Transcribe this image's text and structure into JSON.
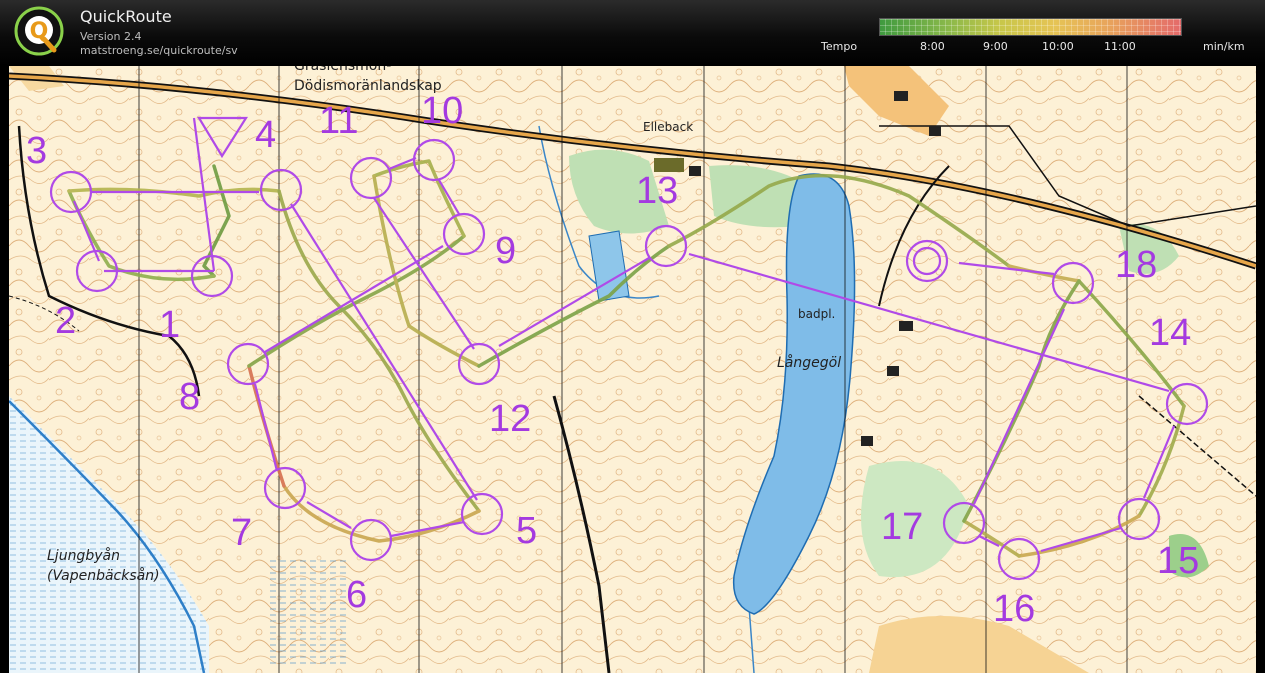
{
  "app": {
    "title": "QuickRoute",
    "version": "Version 2.4",
    "url": "matstroeng.se/quickroute/sv",
    "logo_letter": "Q"
  },
  "legend": {
    "label": "Tempo",
    "ticks": [
      "8:00",
      "9:00",
      "10:00",
      "11:00"
    ],
    "unit": "min/km"
  },
  "map": {
    "labels": {
      "area_name_1": "Gräsiensmon-",
      "area_name_2": "Dödismoränlandskap",
      "village": "Elleback",
      "bath": "badpl.",
      "lake": "Långegöl",
      "river_1": "Ljungbyån",
      "river_2": "(Vapenbäcksån)"
    },
    "controls": [
      "1",
      "2",
      "3",
      "4",
      "5",
      "6",
      "7",
      "8",
      "9",
      "10",
      "11",
      "12",
      "13",
      "14",
      "15",
      "16",
      "17",
      "18"
    ]
  },
  "colors": {
    "course": "#b04ae8",
    "contour": "#c9833a",
    "water": "#7fbce8",
    "green": "#b7dcae",
    "yellow": "#f6cf85",
    "black": "#111111"
  }
}
